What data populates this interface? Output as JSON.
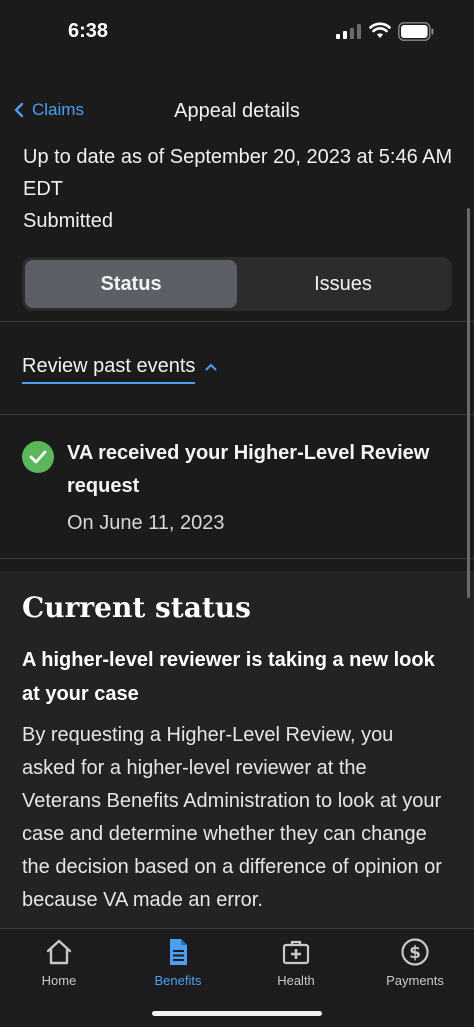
{
  "status_bar": {
    "time": "6:38"
  },
  "nav": {
    "back_label": "Claims",
    "title": "Appeal details"
  },
  "summary": {
    "updated": "Up to date as of September 20, 2023 at 5:46 AM EDT",
    "status": "Submitted"
  },
  "segments": [
    {
      "label": "Status",
      "active": true
    },
    {
      "label": "Issues",
      "active": false
    }
  ],
  "review_link": "Review past events",
  "event": {
    "title": "VA received your Higher-Level Review request",
    "date": "On June 11, 2023"
  },
  "current_status": {
    "heading": "Current status",
    "subheading": "A higher-level reviewer is taking a new look at your case",
    "body": "By requesting a Higher-Level Review, you asked for a higher-level reviewer at the Veterans Benefits Administration to look at your case and determine whether they can change the decision based on a difference of opinion or because VA made an error."
  },
  "tabs": [
    {
      "label": "Home",
      "icon": "home-icon",
      "active": false
    },
    {
      "label": "Benefits",
      "icon": "document-icon",
      "active": true
    },
    {
      "label": "Health",
      "icon": "medical-kit-icon",
      "active": false
    },
    {
      "label": "Payments",
      "icon": "dollar-icon",
      "active": false
    }
  ],
  "colors": {
    "accent": "#4d9ff3",
    "success": "#5cb65a",
    "background": "#1b1b1c"
  }
}
